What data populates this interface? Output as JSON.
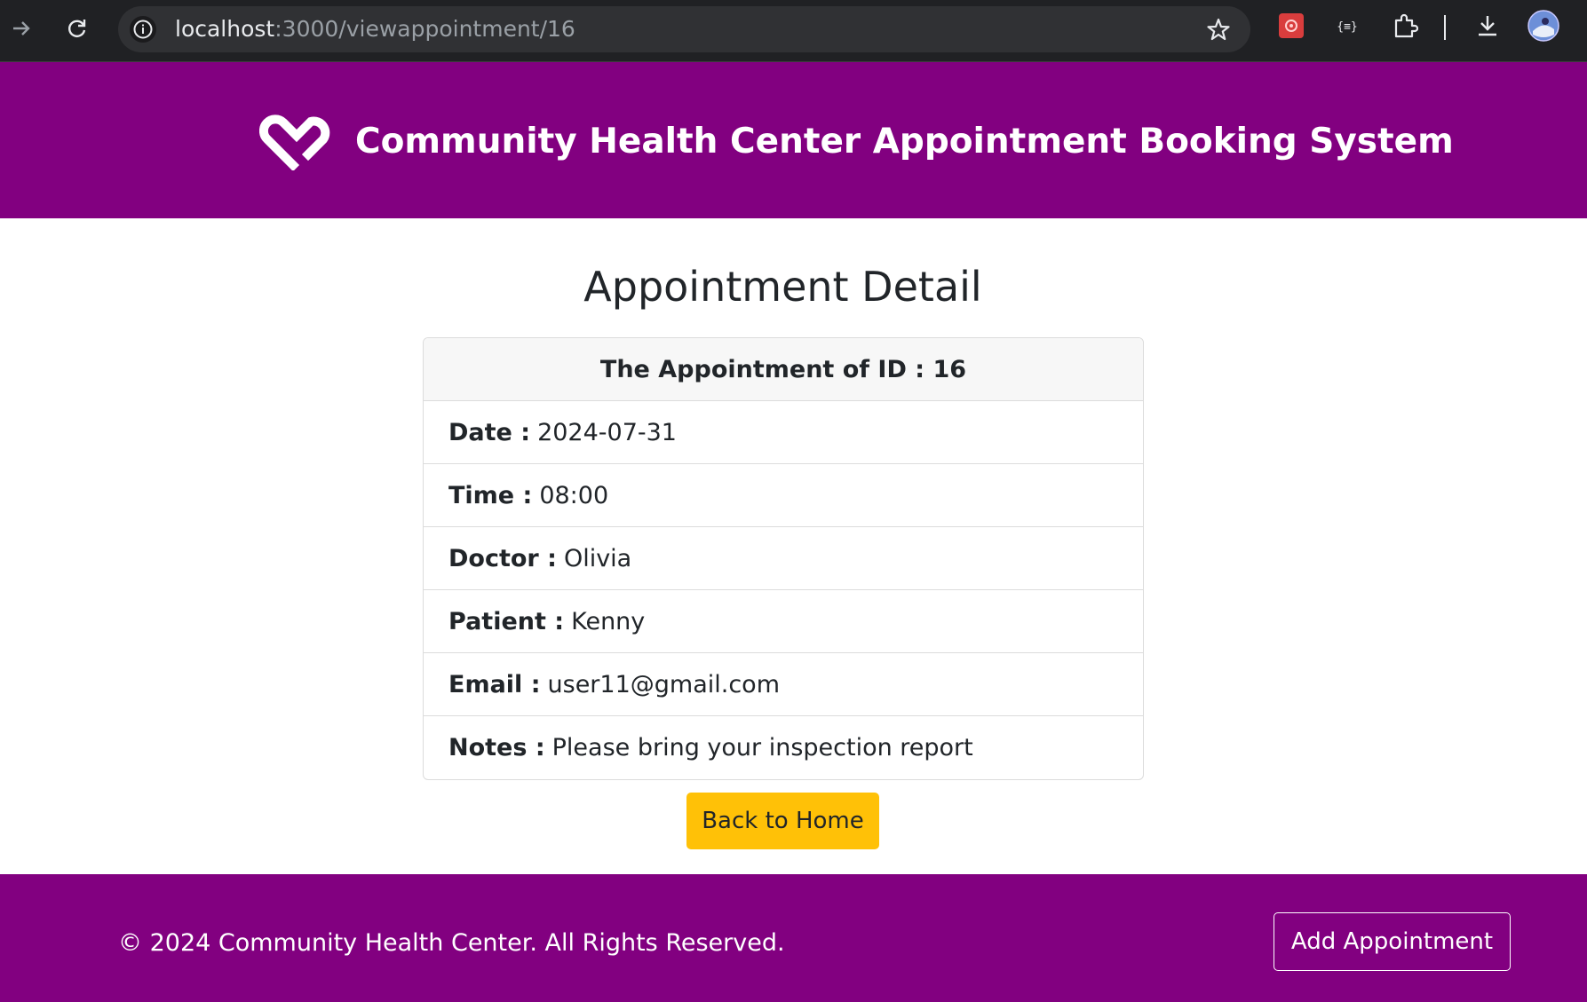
{
  "browser": {
    "url_host": "localhost",
    "url_path": ":3000/viewappointment/16",
    "icons": [
      "forward-icon",
      "reload-icon",
      "info-icon",
      "star-icon",
      "extension-red-icon",
      "json-extension-icon",
      "puzzle-icon",
      "download-icon",
      "profile-avatar"
    ]
  },
  "header": {
    "title": "Community Health Center Appointment Booking System",
    "logo": "heart-logo-icon",
    "background": "#820080"
  },
  "main": {
    "heading": "Appointment Detail",
    "card": {
      "title": "The Appointment of ID : 16",
      "rows": [
        {
          "label": "Date :",
          "value": "2024-07-31"
        },
        {
          "label": "Time :",
          "value": "08:00"
        },
        {
          "label": "Doctor :",
          "value": "Olivia"
        },
        {
          "label": "Patient :",
          "value": "Kenny"
        },
        {
          "label": "Email :",
          "value": "user11@gmail.com"
        },
        {
          "label": "Notes :",
          "value": "Please bring your inspection report"
        }
      ]
    },
    "back_button": "Back to Home",
    "back_button_color": "#ffc107"
  },
  "footer": {
    "copyright": "© 2024 Community Health Center. All Rights Reserved.",
    "add_button": "Add Appointment"
  }
}
